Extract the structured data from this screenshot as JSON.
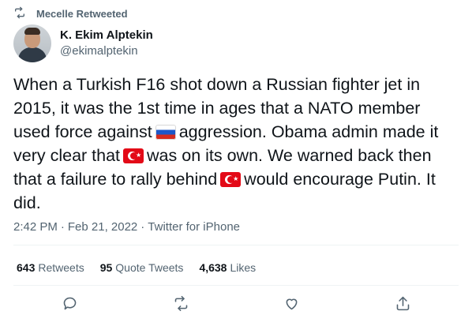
{
  "retweet": {
    "label": "Mecelle Retweeted",
    "icon": "retweet-icon"
  },
  "author": {
    "display_name": "K. Ekim Alptekin",
    "handle": "@ekimalptekin"
  },
  "tweet": {
    "segments": [
      "When a Turkish F16 shot down a Russian fighter jet in 2015, it was the 1st time in ages that a NATO member used force against",
      "aggression. Obama admin made it very clear that",
      "was on its own. We warned back then that a failure to rally behind",
      "would encourage Putin. It did."
    ],
    "flags": [
      "russia-flag-icon",
      "turkey-flag-icon",
      "turkey-flag-icon"
    ]
  },
  "meta": {
    "time": "2:42 PM",
    "separator": "·",
    "date": "Feb 21, 2022",
    "source": "Twitter for iPhone"
  },
  "stats": {
    "retweets": {
      "count": "643",
      "label": "Retweets"
    },
    "quotes": {
      "count": "95",
      "label": "Quote Tweets"
    },
    "likes": {
      "count": "4,638",
      "label": "Likes"
    }
  },
  "actions": [
    "reply-icon",
    "retweet-icon",
    "like-icon",
    "share-icon"
  ],
  "colors": {
    "text": "#0f1419",
    "secondary": "#536471",
    "divider": "#eff3f4"
  }
}
